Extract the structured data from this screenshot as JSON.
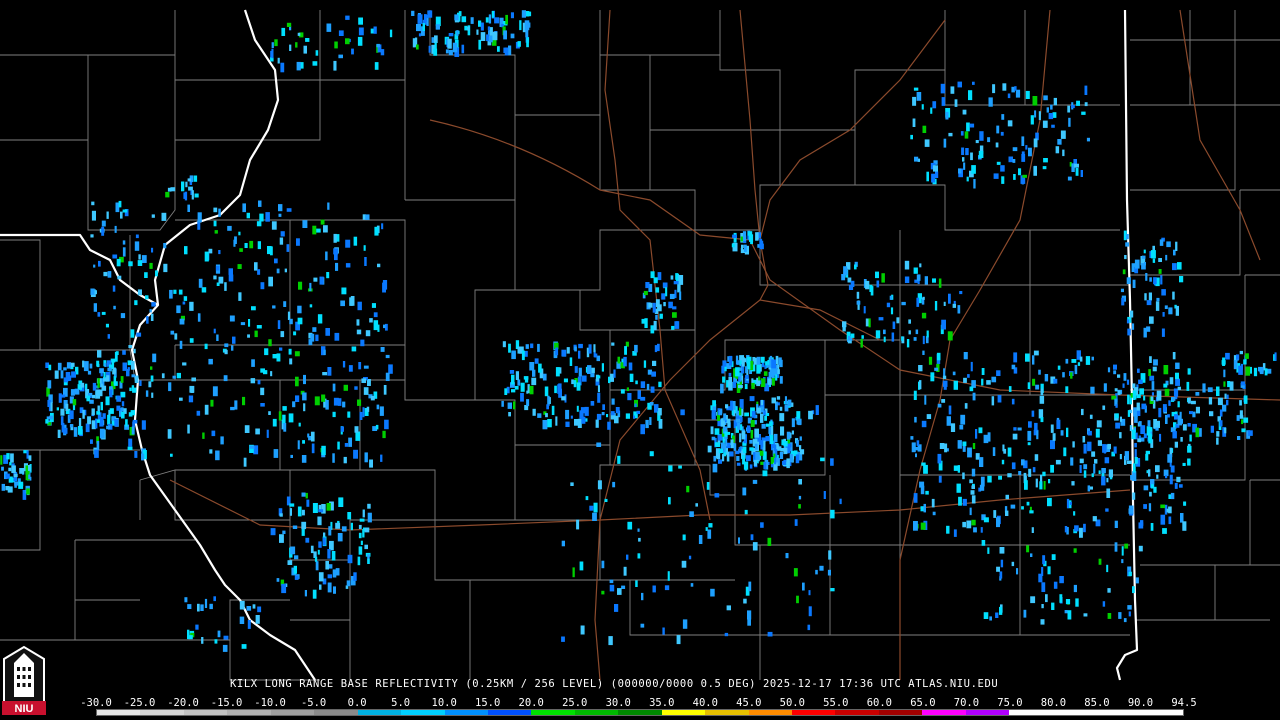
{
  "caption": "KILX LONG RANGE BASE REFLECTIVITY (0.25KM / 256 LEVEL) (000000/0000 0.5 DEG) 2025-12-17 17:36 UTC  ATLAS.NIU.EDU",
  "logo": {
    "text": "NIU",
    "icon": "niu-tower-logo-icon",
    "color": "#c8102e"
  },
  "scale": {
    "labels": [
      "-30.0",
      "-25.0",
      "-20.0",
      "-15.0",
      "-10.0",
      "-5.0",
      "0.0",
      "5.0",
      "10.0",
      "15.0",
      "20.0",
      "25.0",
      "30.0",
      "35.0",
      "40.0",
      "45.0",
      "50.0",
      "55.0",
      "60.0",
      "65.0",
      "70.0",
      "75.0",
      "80.0",
      "85.0",
      "90.0",
      "94.5"
    ],
    "colors": [
      "#e6e6e6",
      "#d4d4d4",
      "#c2c2c2",
      "#b0b0b0",
      "#9e9e9e",
      "#8a8a8a",
      "#00b0e0",
      "#00d0ff",
      "#0090ff",
      "#0050ff",
      "#00e000",
      "#00b800",
      "#008800",
      "#ffff00",
      "#e6c000",
      "#ff8c00",
      "#ff0000",
      "#c80000",
      "#a00000",
      "#ff00ff",
      "#b000ff",
      "#ffffff",
      "#ffffff",
      "#ffffff",
      "#ffffff"
    ]
  },
  "colors": {
    "background": "#000000",
    "county_lines": "#7f7f7f",
    "state_lines": "#ffffff",
    "highways": "#8b4a2c",
    "echo_light": "#1ea0ff",
    "echo_medium": "#00e0ff",
    "echo_green": "#00d000"
  }
}
